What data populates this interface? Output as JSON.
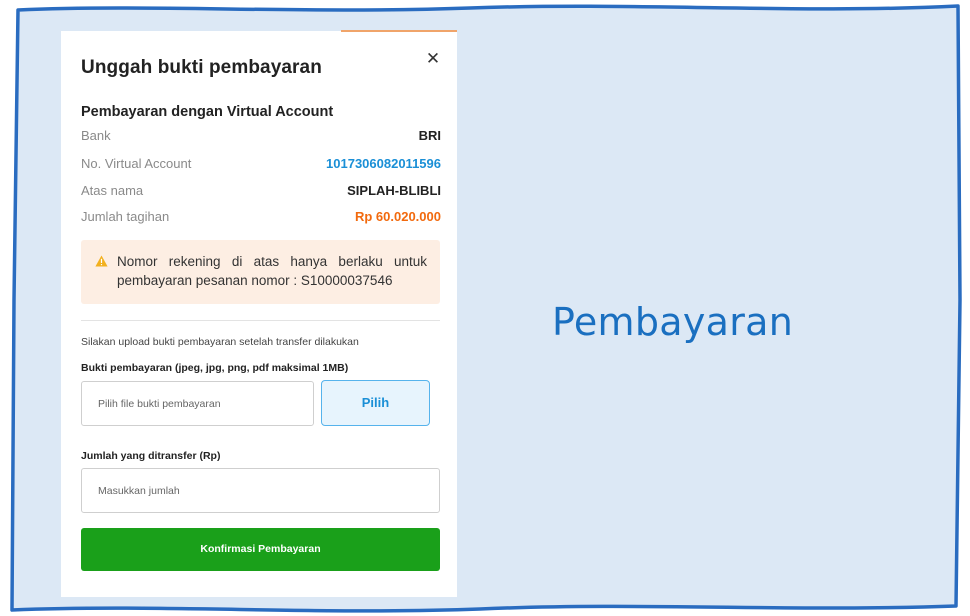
{
  "colors": {
    "frame_fill": "#dce8f5",
    "frame_border": "#2a6cc0",
    "accent_blue": "#1a8fd6",
    "amount_orange": "#f26a0e",
    "confirm_green": "#1aa01a",
    "alert_bg": "#fdeee3",
    "warning_yellow": "#f2b01e"
  },
  "modal": {
    "title": "Unggah bukti pembayaran",
    "close_icon": "close-icon",
    "section_title": "Pembayaran dengan Virtual Account",
    "details": [
      {
        "label": "Bank",
        "value": "BRI"
      },
      {
        "label": "No. Virtual Account",
        "value": "1017306082011596"
      },
      {
        "label": "Atas nama",
        "value": "SIPLAH-BLIBLI"
      },
      {
        "label": "Jumlah tagihan",
        "value": "Rp 60.020.000"
      }
    ],
    "alert": {
      "icon": "warning-icon",
      "text": "Nomor rekening di atas hanya berlaku untuk pembayaran pesanan nomor : S10000037546"
    },
    "upload_hint": "Silakan upload bukti pembayaran setelah transfer dilakukan",
    "file_label": "Bukti pembayaran (jpeg, jpg, png, pdf maksimal 1MB)",
    "file_placeholder": "Pilih file bukti pembayaran",
    "pick_button": "Pilih",
    "amount_label": "Jumlah yang ditransfer (Rp)",
    "amount_placeholder": "Masukkan jumlah",
    "confirm_button": "Konfirmasi Pembayaran"
  },
  "side_title": "Pembayaran"
}
